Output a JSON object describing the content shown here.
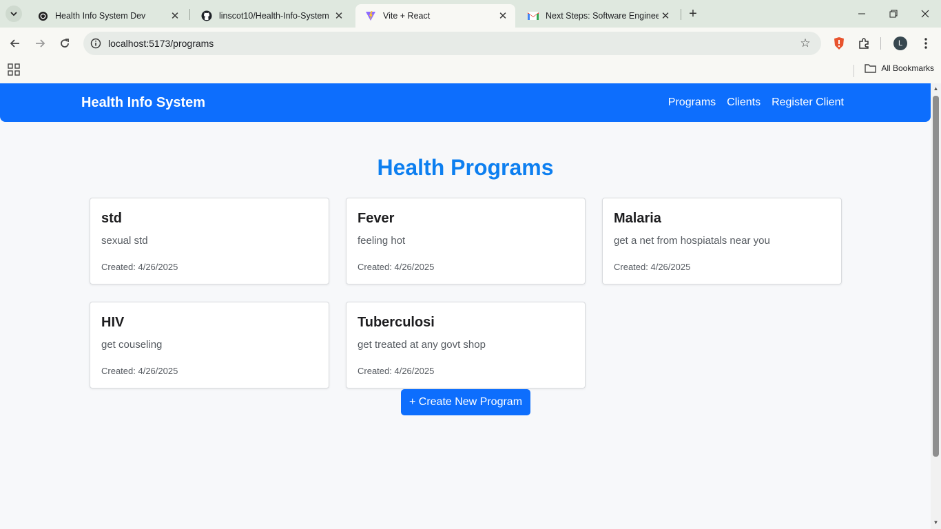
{
  "browser": {
    "tabs": [
      {
        "title": "Health Info System Dev",
        "icon": "openai-icon"
      },
      {
        "title": "linscot10/Health-Info-System",
        "icon": "github-icon"
      },
      {
        "title": "Vite + React",
        "icon": "vite-icon",
        "active": true
      },
      {
        "title": "Next Steps: Software Engineerin",
        "icon": "gmail-icon"
      }
    ],
    "url": "localhost:5173/programs",
    "profile_initial": "L",
    "bookmarks_label": "All Bookmarks"
  },
  "navbar": {
    "brand": "Health Info System",
    "links": [
      "Programs",
      "Clients",
      "Register Client"
    ]
  },
  "page": {
    "title": "Health Programs",
    "programs": [
      {
        "name": "std",
        "description": "sexual std",
        "created": "Created: 4/26/2025"
      },
      {
        "name": "Fever",
        "description": "feeling hot",
        "created": "Created: 4/26/2025"
      },
      {
        "name": "Malaria",
        "description": "get a net from hospiatals near you",
        "created": "Created: 4/26/2025"
      },
      {
        "name": "HIV",
        "description": "get couseling",
        "created": "Created: 4/26/2025"
      },
      {
        "name": "Tuberculosi",
        "description": "get treated at any govt shop",
        "created": "Created: 4/26/2025"
      }
    ],
    "create_button": "+ Create New Program"
  },
  "colors": {
    "primary": "#0d6efd",
    "title": "#0d7ff0",
    "background": "#f7f8fa"
  }
}
